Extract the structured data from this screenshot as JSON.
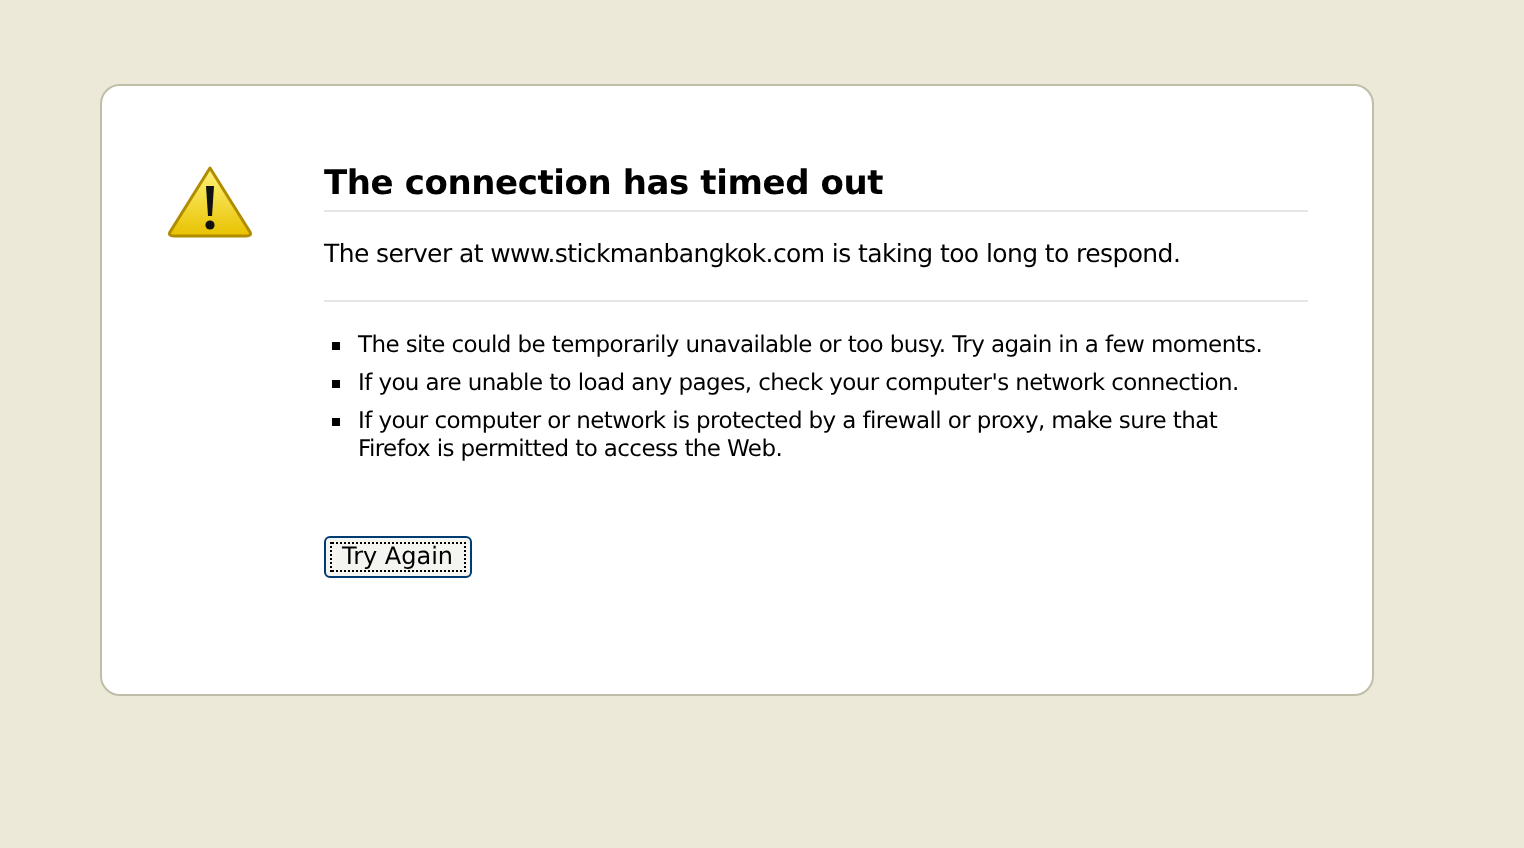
{
  "title": "The connection has timed out",
  "message": "The server at www.stickmanbangkok.com is taking too long to respond.",
  "suggestions": [
    "The site could be temporarily unavailable or too busy. Try again in a few moments.",
    "If you are unable to load any pages, check your computer's network connection.",
    "If your computer or network is protected by a firewall or proxy, make sure that Firefox is permitted to access the Web."
  ],
  "button": "Try Again"
}
